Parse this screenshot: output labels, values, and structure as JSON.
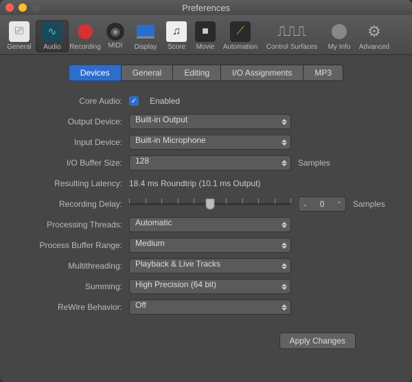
{
  "window": {
    "title": "Preferences"
  },
  "toolbar": [
    {
      "id": "general",
      "label": "General"
    },
    {
      "id": "audio",
      "label": "Audio"
    },
    {
      "id": "recording",
      "label": "Recording"
    },
    {
      "id": "midi",
      "label": "MIDI"
    },
    {
      "id": "display",
      "label": "Display"
    },
    {
      "id": "score",
      "label": "Score"
    },
    {
      "id": "movie",
      "label": "Movie"
    },
    {
      "id": "automation",
      "label": "Automation"
    },
    {
      "id": "control-surfaces",
      "label": "Control Surfaces"
    },
    {
      "id": "my-info",
      "label": "My Info"
    },
    {
      "id": "advanced",
      "label": "Advanced"
    }
  ],
  "tabs": {
    "devices": "Devices",
    "general": "General",
    "editing": "Editing",
    "io": "I/O Assignments",
    "mp3": "MP3"
  },
  "labels": {
    "core_audio": "Core Audio:",
    "output_device": "Output Device:",
    "input_device": "Input Device:",
    "io_buffer": "I/O Buffer Size:",
    "resulting_latency": "Resulting Latency:",
    "recording_delay": "Recording Delay:",
    "processing_threads": "Processing Threads:",
    "process_buffer_range": "Process Buffer Range:",
    "multithreading": "Multithreading:",
    "summing": "Summing:",
    "rewire": "ReWire Behavior:"
  },
  "values": {
    "enabled_label": "Enabled",
    "output_device": "Built-in Output",
    "input_device": "Built-in Microphone",
    "io_buffer": "128",
    "io_buffer_suffix": "Samples",
    "resulting_latency": "18.4 ms Roundtrip (10.1 ms Output)",
    "recording_delay": "0",
    "recording_delay_suffix": "Samples",
    "processing_threads": "Automatic",
    "process_buffer_range": "Medium",
    "multithreading": "Playback & Live Tracks",
    "summing": "High Precision (64 bit)",
    "rewire": "Off"
  },
  "buttons": {
    "apply": "Apply Changes"
  }
}
